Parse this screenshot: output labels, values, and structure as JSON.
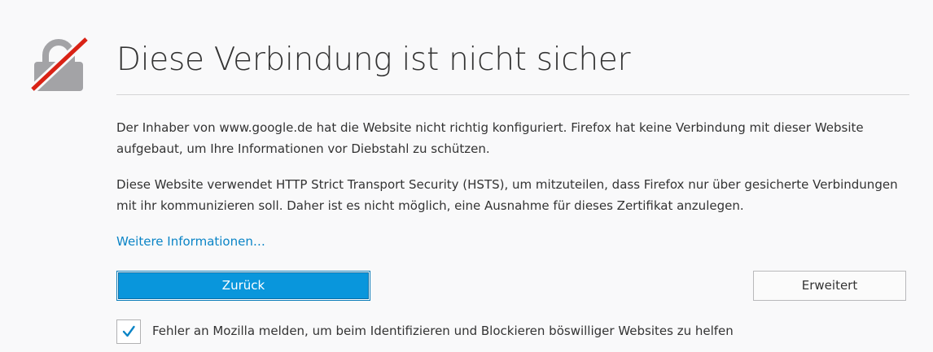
{
  "page": {
    "title": "Diese Verbindung ist nicht sicher",
    "paragraph1": "Der Inhaber von www.google.de hat die Website nicht richtig konfiguriert. Firefox hat keine Verbindung mit dieser Website aufgebaut, um Ihre Informationen vor Diebstahl zu schützen.",
    "paragraph2": "Diese Website verwendet HTTP Strict Transport Security (HSTS), um mitzuteilen, dass Firefox nur über gesicherte Verbindungen mit ihr kommunizieren soll. Daher ist es nicht möglich, eine Ausnahme für dieses Zertifikat anzulegen.",
    "learn_more_link": "Weitere Informationen…"
  },
  "buttons": {
    "back_label": "Zurück",
    "advanced_label": "Erweitert"
  },
  "report": {
    "checked": true,
    "label": "Fehler an Mozilla melden, um beim Identifizieren und Blockieren böswilliger Websites zu helfen"
  },
  "icons": {
    "lock": "broken-lock-icon",
    "check": "checkmark-icon"
  },
  "colors": {
    "accent": "#0996dc",
    "link": "#0a84c6",
    "strike": "#d92215",
    "lock_gray": "#a3a3a6"
  }
}
